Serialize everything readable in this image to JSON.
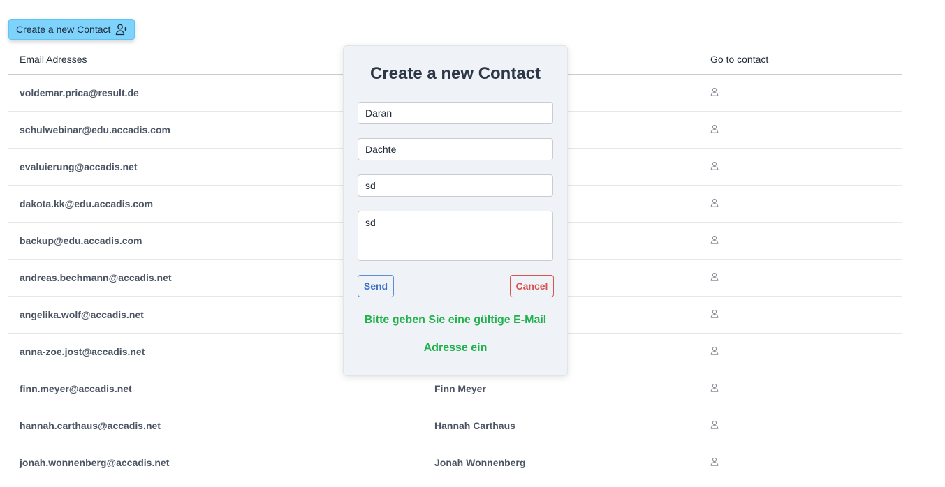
{
  "toolbar": {
    "create_label": "Create a new Contact",
    "create_icon": "user-plus-icon"
  },
  "table": {
    "headers": {
      "email": "Email Adresses",
      "name": "",
      "goto": "Go to contact"
    },
    "row_icon": "user-icon",
    "rows": [
      {
        "email": "voldemar.prica@result.de",
        "name": ""
      },
      {
        "email": "schulwebinar@edu.accadis.com",
        "name": ""
      },
      {
        "email": "evaluierung@accadis.net",
        "name": ""
      },
      {
        "email": "dakota.kk@edu.accadis.com",
        "name": ""
      },
      {
        "email": "backup@edu.accadis.com",
        "name": ""
      },
      {
        "email": "andreas.bechmann@accadis.net",
        "name": ""
      },
      {
        "email": "angelika.wolf@accadis.net",
        "name": ""
      },
      {
        "email": "anna-zoe.jost@accadis.net",
        "name": ""
      },
      {
        "email": "finn.meyer@accadis.net",
        "name": "Finn Meyer"
      },
      {
        "email": "hannah.carthaus@accadis.net",
        "name": "Hannah Carthaus"
      },
      {
        "email": "jonah.wonnenberg@accadis.net",
        "name": "Jonah Wonnenberg"
      }
    ]
  },
  "modal": {
    "title": "Create a new Contact",
    "fields": {
      "first_name": "Daran",
      "last_name": "Dachte",
      "email": "sd",
      "message": "sd"
    },
    "send_label": "Send",
    "cancel_label": "Cancel",
    "error_line1": "Bitte geben Sie eine gültige E-Mail",
    "error_line2": "Adresse ein"
  },
  "colors": {
    "accent_button": "#7dd3fc",
    "send": "#3b72c8",
    "cancel": "#d9534f",
    "error_text": "#22b14c"
  }
}
